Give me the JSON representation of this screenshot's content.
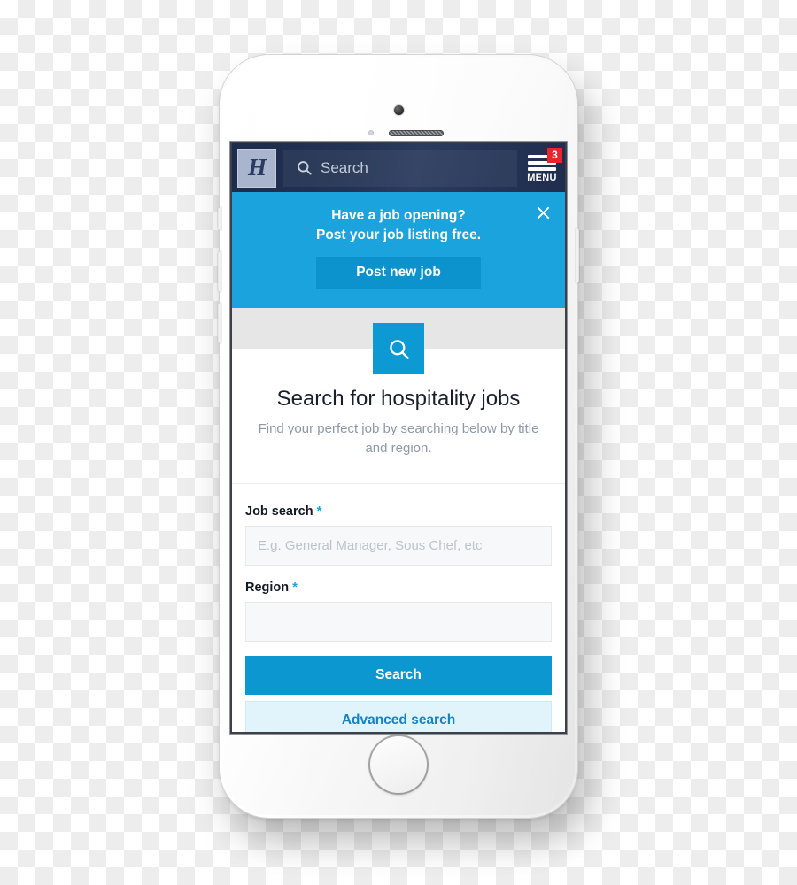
{
  "device": {
    "type": "white-smartphone",
    "camera": "front-camera",
    "speaker": "earpiece-speaker",
    "home_button": "home-button"
  },
  "navbar": {
    "logo_glyph": "H",
    "search_placeholder": "Search",
    "search_icon": "search-icon",
    "menu_label": "MENU",
    "menu_badge": "3",
    "bg_color": "#233353"
  },
  "promo": {
    "line1": "Have a job opening?",
    "line2": "Post your job listing free.",
    "button_label": "Post new job",
    "close_icon": "close-icon",
    "bg_color": "#1ba3dd",
    "button_color": "#0c92cd"
  },
  "hero": {
    "icon": "search-icon",
    "icon_bg": "#0d99d3",
    "title": "Search for hospitality jobs",
    "subtitle": "Find your perfect job by searching below by title and region."
  },
  "form": {
    "fields": [
      {
        "label": "Job search",
        "required_marker": "*",
        "placeholder": "E.g. General Manager, Sous Chef, etc",
        "value": ""
      },
      {
        "label": "Region",
        "required_marker": "*",
        "placeholder": "",
        "value": ""
      }
    ],
    "required_color": "#1ba3dd",
    "primary_button": "Search",
    "secondary_button": "Advanced search",
    "primary_color": "#0d97d1",
    "secondary_color": "#e2f4fb"
  }
}
